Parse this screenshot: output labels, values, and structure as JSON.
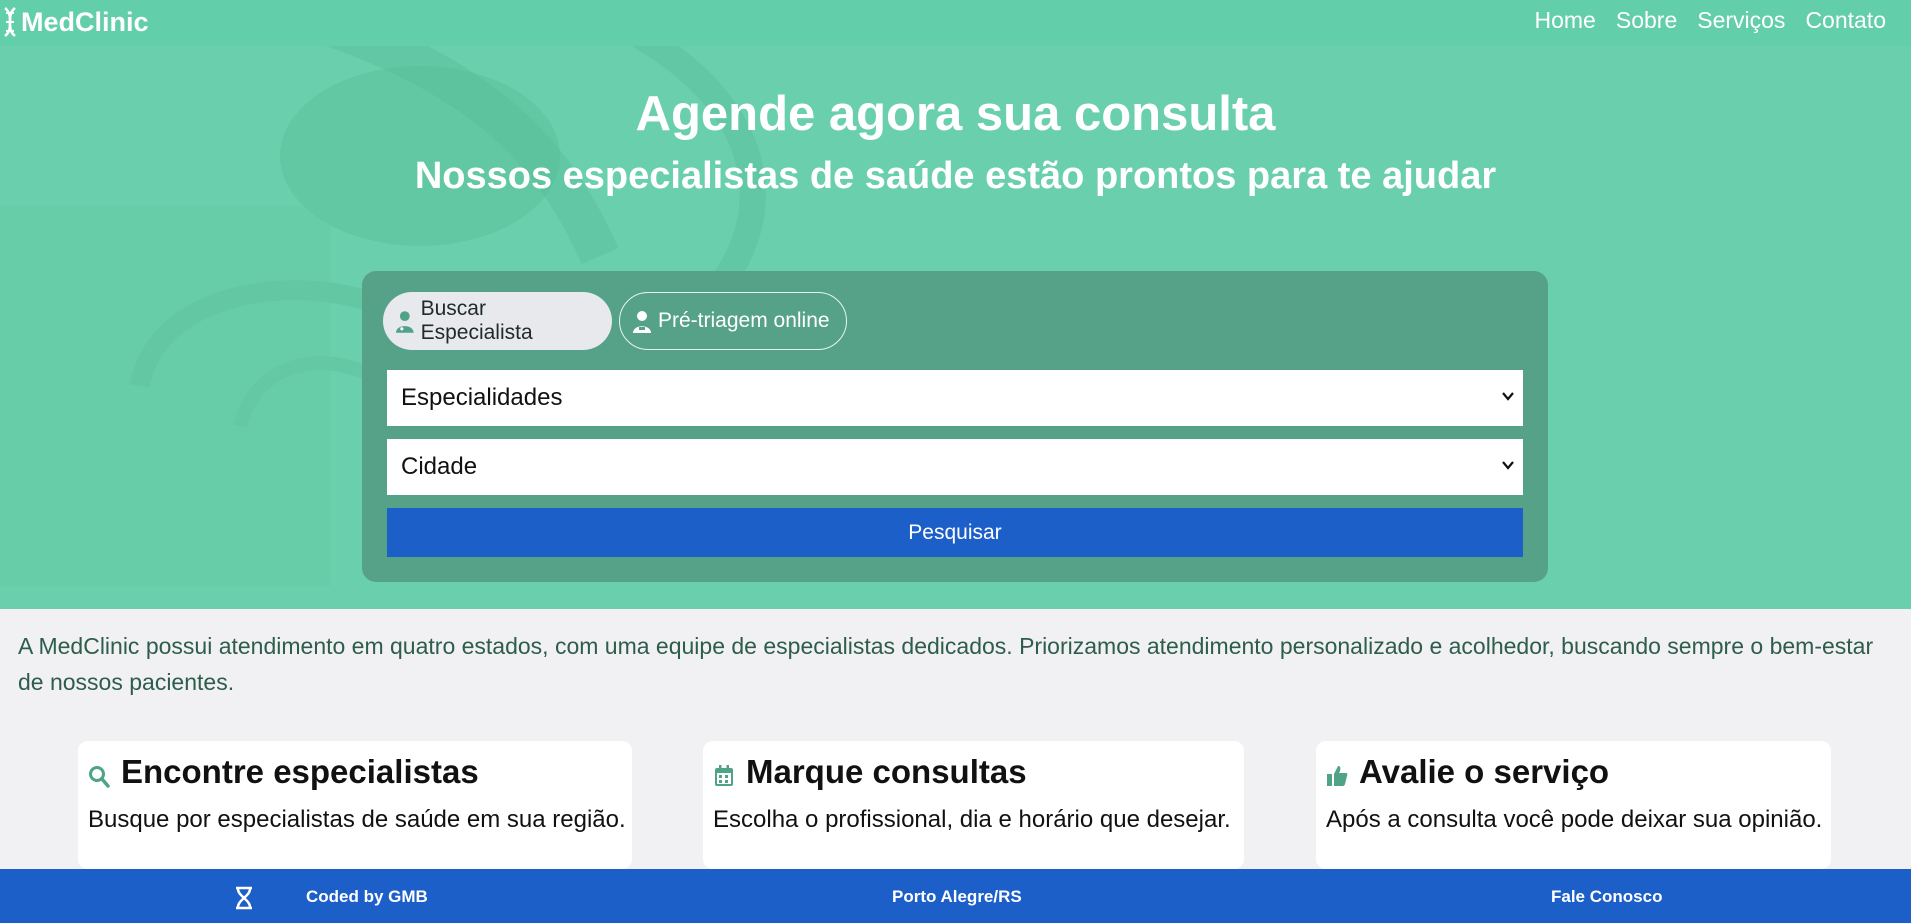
{
  "header": {
    "logo_text": "MedClinic",
    "nav": [
      "Home",
      "Sobre",
      "Serviços",
      "Contato"
    ]
  },
  "hero": {
    "title": "Agende agora sua consulta",
    "subtitle": "Nossos especialistas de saúde estão prontos para te ajudar"
  },
  "search_panel": {
    "tabs": [
      "Buscar Especialista",
      "Pré-triagem online"
    ],
    "active_tab": "Buscar Especialista",
    "specialty_select": "Especialidades",
    "city_select": "Cidade",
    "search_button": "Pesquisar"
  },
  "intro_text": "A MedClinic possui atendimento em quatro estados, com uma equipe de especialistas dedicados. Priorizamos atendimento personalizado e acolhedor, buscando sempre o bem-estar de nossos pacientes.",
  "features": [
    {
      "icon": "search-icon",
      "title": "Encontre especialistas",
      "description": "Busque por especialistas de saúde em sua região."
    },
    {
      "icon": "calendar-icon",
      "title": "Marque consultas",
      "description": "Escolha o profissional, dia e horário que desejar."
    },
    {
      "icon": "thumbs-up-icon",
      "title": "Avalie o serviço",
      "description": "Após a consulta você pode deixar sua opinião."
    }
  ],
  "footer": {
    "coded_by": "Coded by GMB",
    "city": "Porto Alegre/RS",
    "contact": "Fale Conosco"
  },
  "colors": {
    "primary_green": "#63ceaa",
    "panel_green": "#56a288",
    "accent_blue": "#1c5fc9"
  }
}
